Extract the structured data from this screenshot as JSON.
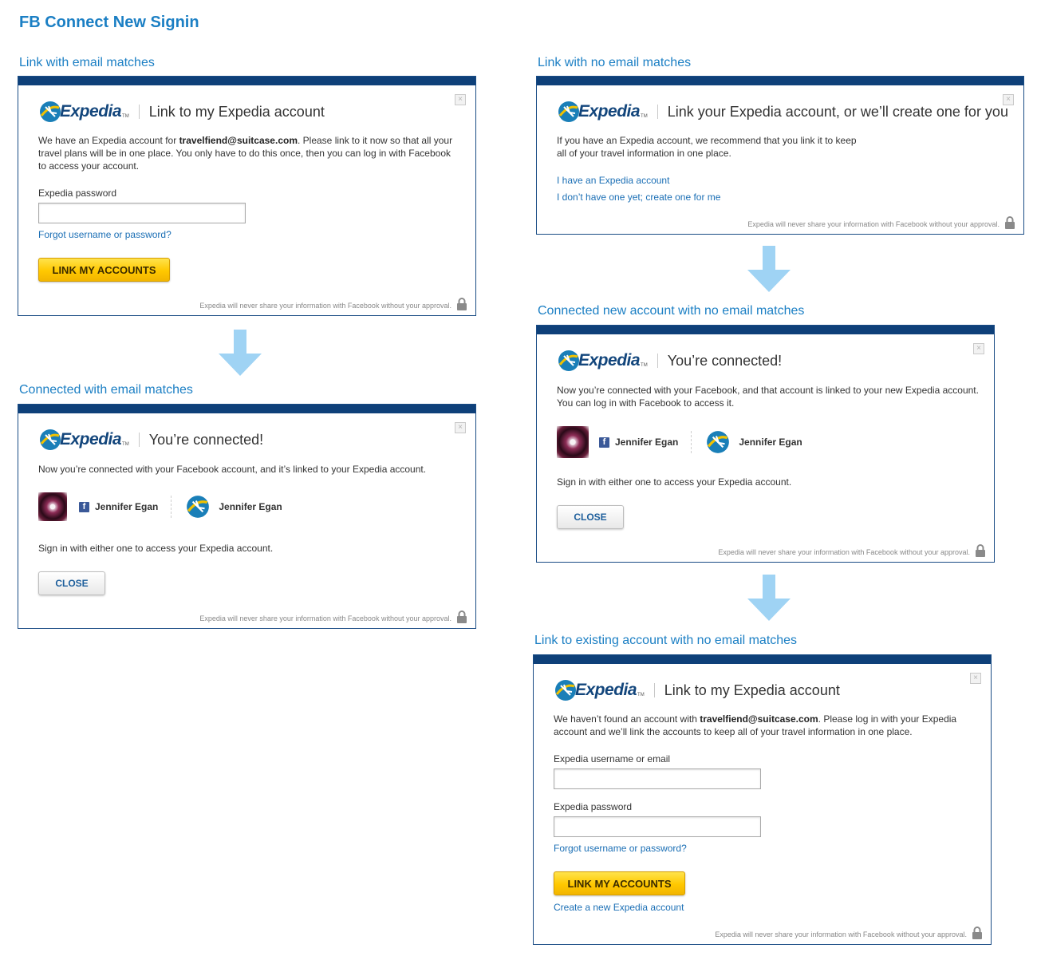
{
  "page": {
    "title": "FB Connect New Signin"
  },
  "brand": {
    "name": "Expedia",
    "tm": "TM",
    "colors": {
      "navy": "#0e4079",
      "link": "#1b6fb5",
      "label": "#1b7fc4",
      "button_yellow": "#ffc800"
    }
  },
  "common": {
    "footer_note": "Expedia will never share your information with Facebook without your approval.",
    "close_label": "CLOSE",
    "link_accounts_label": "LINK MY ACCOUNTS",
    "forgot_link": "Forgot username or password?",
    "close_icon": "×",
    "user_name": "Jennifer Egan",
    "signin_note": "Sign in with either one to access your Expedia account."
  },
  "panels": {
    "link_email": {
      "label": "Link with email matches",
      "title": "Link to my Expedia account",
      "body_before": "We have an Expedia account for ",
      "email": "travelfiend@suitcase.com",
      "body_after": ". Please link to it now so that all your travel plans will be in one place. You only have to do this once, then you can log in with Facebook to access your account.",
      "password_label": "Expedia password",
      "password_value": ""
    },
    "connected_email": {
      "label": "Connected with email matches",
      "title": "You’re connected!",
      "body": "Now you’re connected with your Facebook account, and it’s linked to your Expedia account."
    },
    "link_no_email": {
      "label": "Link with no email matches",
      "title": "Link your Expedia account, or we’ll create one for you",
      "body": "If you have an Expedia account, we recommend that you link it to keep all of your travel information in one place.",
      "option_have": "I have an Expedia account",
      "option_create": "I don’t have one yet; create one for me"
    },
    "connected_new": {
      "label": "Connected new account with no email matches",
      "title": "You’re connected!",
      "body": "Now you’re connected with your Facebook, and that account is linked to your new Expedia account. You can log in with Facebook to access it."
    },
    "link_existing": {
      "label": "Link to existing account with no email matches",
      "title": "Link to my Expedia account",
      "body_before": "We haven’t found an account with ",
      "email": "travelfiend@suitcase.com",
      "body_after": ". Please log in with your Expedia account and we’ll link the accounts to keep all of your travel information in one place.",
      "username_label": "Expedia username or email",
      "username_value": "",
      "password_label": "Expedia password",
      "password_value": "",
      "create_link": "Create a new Expedia account"
    }
  }
}
